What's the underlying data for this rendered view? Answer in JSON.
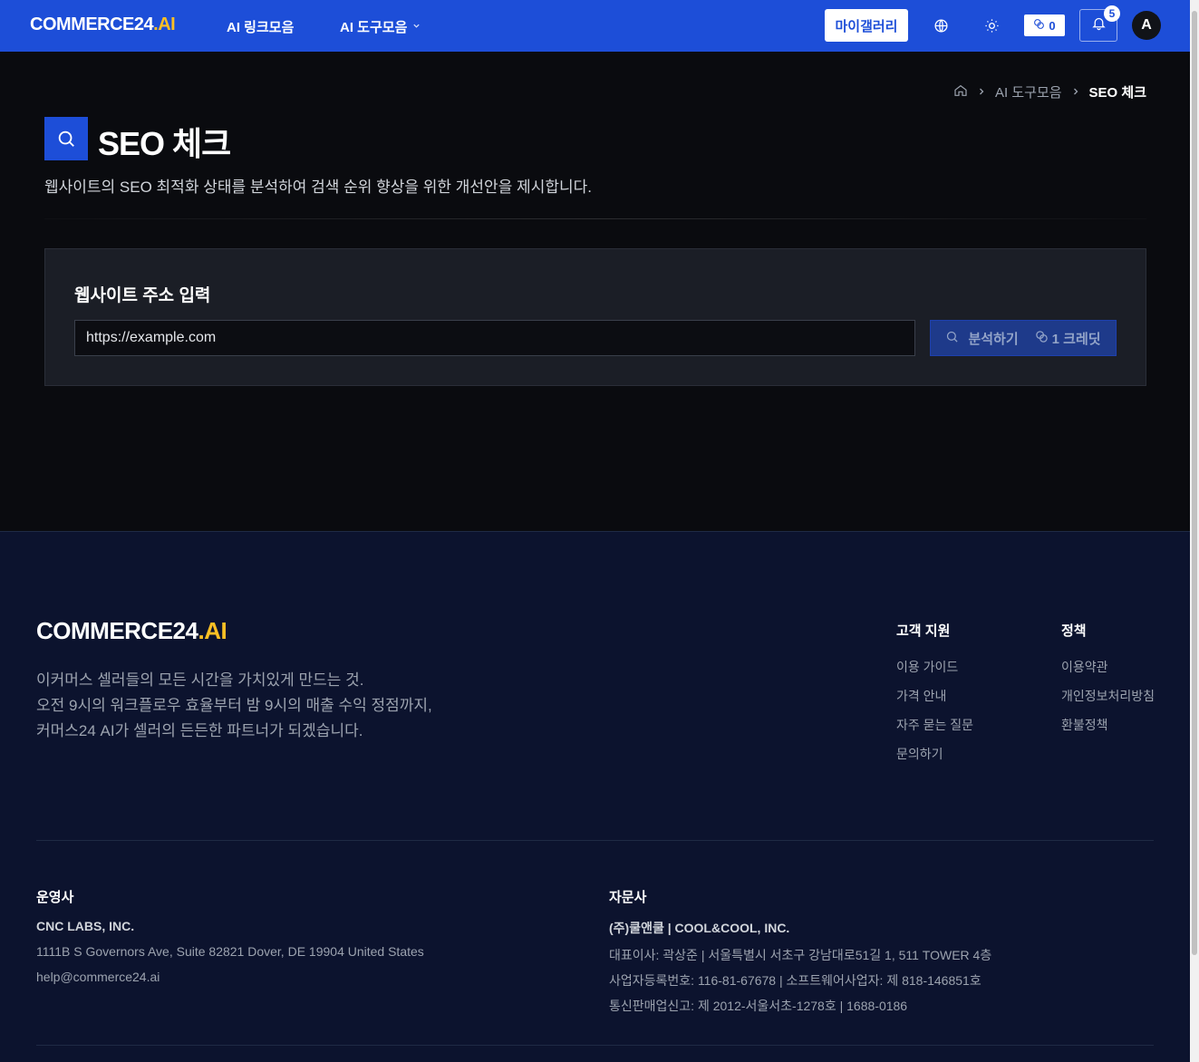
{
  "header": {
    "logo_main": "COMMERCE24",
    "logo_ai": ".AI",
    "nav_links_label": "AI 링크모음",
    "nav_tools_label": "AI 도구모음",
    "gallery_label": "마이갤러리",
    "credits": "0",
    "notification_count": "5",
    "avatar_initial": "A"
  },
  "breadcrumb": {
    "parent": "AI 도구모음",
    "current": "SEO 체크"
  },
  "page": {
    "title": "SEO 체크",
    "description": "웹사이트의 SEO 최적화 상태를 분석하여 검색 순위 향상을 위한 개선안을 제시합니다."
  },
  "form": {
    "label": "웹사이트 주소 입력",
    "placeholder": "https://example.com",
    "analyze_label": "분석하기",
    "cost_label": "1 크레딧"
  },
  "footer": {
    "logo_main": "COMMERCE24",
    "logo_ai": ".AI",
    "tagline": [
      "이커머스 셀러들의 모든 시간을 가치있게 만드는 것.",
      "오전 9시의 워크플로우 효율부터 밤 9시의 매출 수익 정점까지,",
      "커머스24 AI가 셀러의 든든한 파트너가 되겠습니다."
    ],
    "support": {
      "heading": "고객 지원",
      "links": [
        "이용 가이드",
        "가격 안내",
        "자주 묻는 질문",
        "문의하기"
      ]
    },
    "policy": {
      "heading": "정책",
      "links": [
        "이용약관",
        "개인정보처리방침",
        "환불정책"
      ]
    },
    "operator": {
      "heading": "운영사",
      "name": "CNC LABS, INC.",
      "address": "1111B S Governors Ave, Suite 82821 Dover, DE 19904 United States",
      "email": "help@commerce24.ai"
    },
    "advisor": {
      "heading": "자문사",
      "name": "(주)쿨앤쿨 | COOL&COOL, INC.",
      "line1": "대표이사: 곽상준 | 서울특별시 서초구 강남대로51길 1, 511 TOWER 4층",
      "line2": "사업자등록번호: 116-81-67678 | 소프트웨어사업자: 제 818-146851호",
      "line3": "통신판매업신고: 제 2012-서울서초-1278호 | 1688-0186"
    }
  },
  "colors": {
    "brand": "#1d4ed8",
    "accent": "#fbbf24",
    "footer_bg": "#0c132e"
  }
}
